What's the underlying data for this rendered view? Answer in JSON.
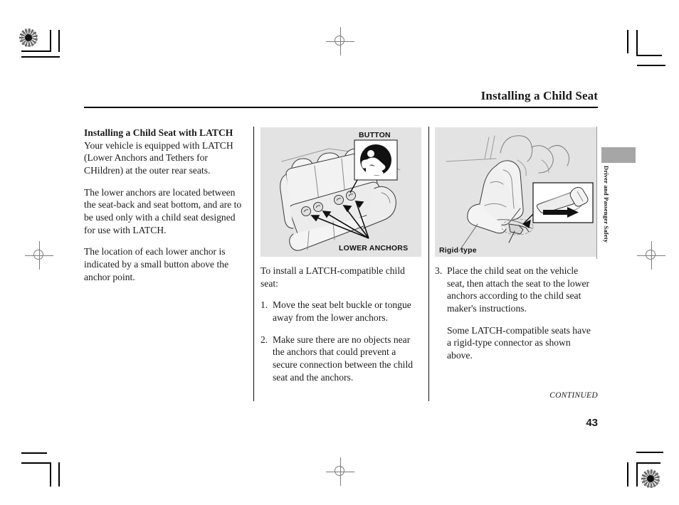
{
  "page": {
    "running_head": "Installing a Child Seat",
    "continued_note": "CONTINUED",
    "page_number": "43",
    "side_tab_label": "Driver and Passenger Safety"
  },
  "left_column": {
    "heading": "Installing a Child Seat with LATCH",
    "paragraphs": [
      "Your vehicle is equipped with LATCH (Lower Anchors and Tethers for CHildren) at the outer rear seats.",
      "The lower anchors are located between the seat-back and seat bottom, and are to be used only with a child seat designed for use with LATCH.",
      "The location of each lower anchor is indicated by a small button above the anchor point."
    ]
  },
  "middle_column": {
    "intro": "To install a LATCH-compatible child seat:",
    "steps": [
      {
        "num": "1.",
        "text": "Move the seat belt buckle or tongue away from the lower anchors."
      },
      {
        "num": "2.",
        "text": "Make sure there are no objects near the anchors that could prevent a secure connection between the child seat and the anchors."
      }
    ]
  },
  "right_column": {
    "steps": [
      {
        "num": "3.",
        "text": "Place the child seat on the vehicle seat, then attach the seat to the lower anchors according to the child seat maker's instructions."
      }
    ],
    "note": "Some LATCH-compatible seats have a rigid-type connector as shown above."
  },
  "figures": {
    "anchors": {
      "label_button": "BUTTON",
      "label_lower_anchors": "LOWER ANCHORS"
    },
    "rigid": {
      "caption": "Rigid type"
    }
  },
  "colors": {
    "figure_background": "#e3e3e3",
    "tab_block": "#a6a6a6",
    "ink": "#1a1a1a"
  }
}
